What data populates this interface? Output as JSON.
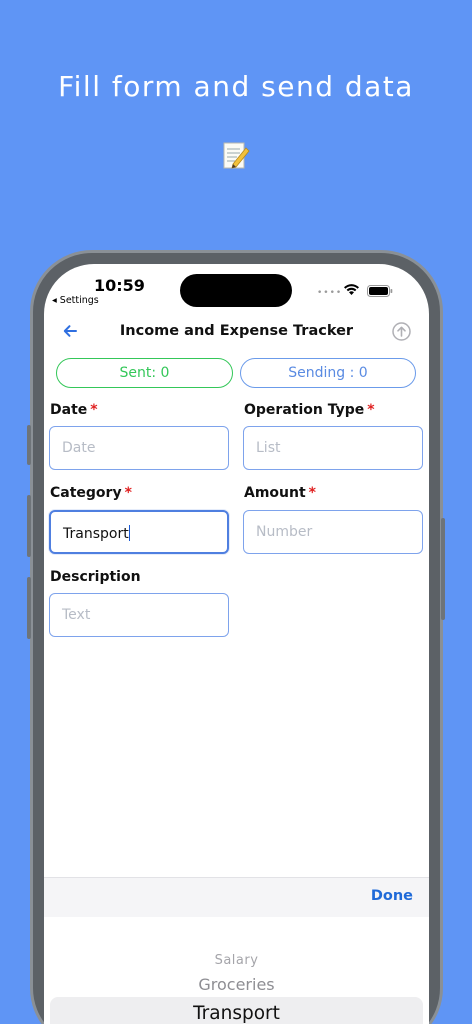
{
  "banner": {
    "headline": "Fill form and send data",
    "icon": "memo-icon"
  },
  "status_bar": {
    "time": "10:59",
    "back_app": "◂ Settings",
    "dots": "••••"
  },
  "nav": {
    "title": "Income and Expense Tracker",
    "back_icon": "arrow-left-icon",
    "upload_icon": "upload-circle-icon"
  },
  "counters": {
    "sent": "Sent: 0",
    "sending": "Sending : 0"
  },
  "form": {
    "date": {
      "label": "Date",
      "required": "*",
      "placeholder": "Date"
    },
    "operation_type": {
      "label": "Operation Type",
      "required": "*",
      "placeholder": "List"
    },
    "category": {
      "label": "Category",
      "required": "*",
      "value": "Transport"
    },
    "amount": {
      "label": "Amount",
      "required": "*",
      "placeholder": "Number"
    },
    "description": {
      "label": "Description",
      "placeholder": "Text"
    }
  },
  "keyboard_toolbar": {
    "done": "Done"
  },
  "picker": {
    "options": [
      "Salary",
      "Groceries",
      "Transport"
    ],
    "selected": "Transport"
  },
  "colors": {
    "background": "#5f95f5",
    "sent": "#34c759",
    "sending": "#5a8be2",
    "accent": "#1f6ad8",
    "required": "#e02020"
  }
}
